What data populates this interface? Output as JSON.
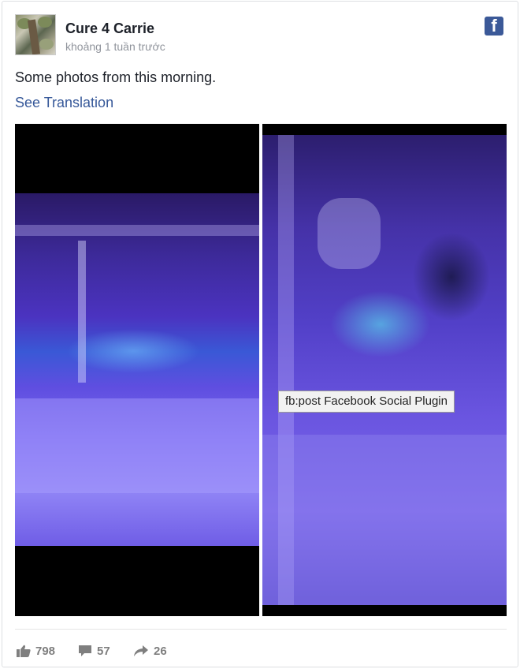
{
  "post": {
    "author": "Cure 4 Carrie",
    "time": "khoảng 1 tuần trước",
    "text": "Some photos from this morning.",
    "see_translation": "See Translation"
  },
  "tooltip": "fb:post Facebook Social Plugin",
  "footer": {
    "likes": "798",
    "comments": "57",
    "shares": "26"
  },
  "colors": {
    "link": "#365899",
    "facebook": "#3b5998",
    "stat": "#7f7f7f"
  },
  "icons": [
    "facebook-icon",
    "like-icon",
    "comment-icon",
    "share-icon"
  ]
}
